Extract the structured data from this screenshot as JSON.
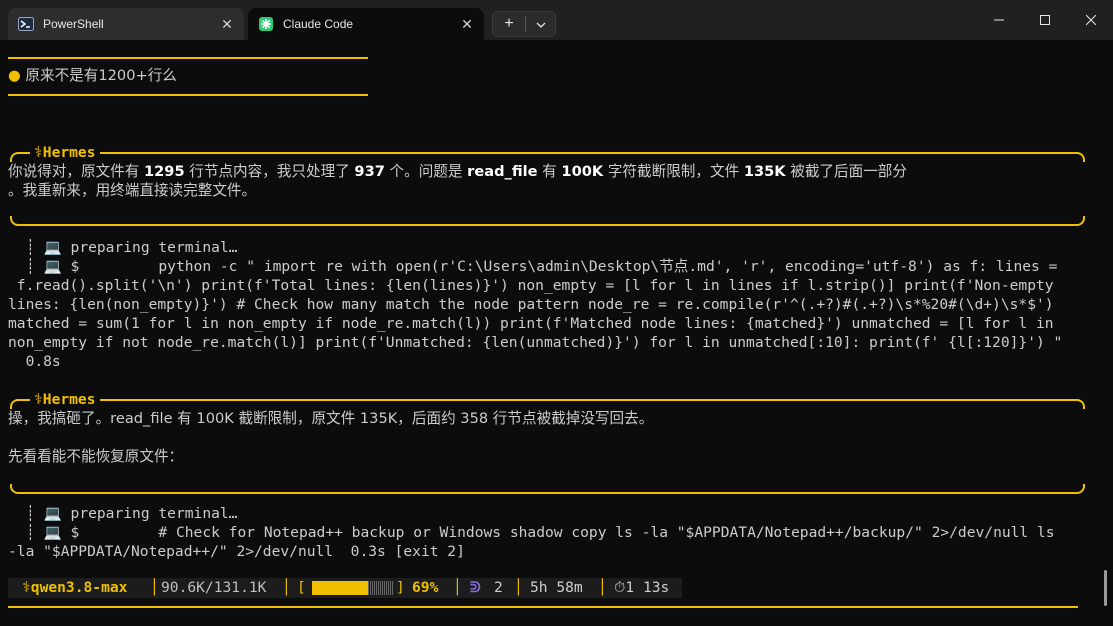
{
  "window": {
    "tabs": [
      {
        "label": "PowerShell"
      },
      {
        "label": "Claude Code"
      }
    ],
    "new_tab": "+",
    "dropdown": "⌄",
    "controls": {
      "minimize": "—",
      "maximize": "☐",
      "close": "✕"
    }
  },
  "colors": {
    "accent": "#f0c000",
    "background": "#0c0c0c",
    "text": "#cccccc"
  },
  "user_message": "原来不是有1200+行么",
  "blocks": [
    {
      "speaker": "⚕Hermes",
      "line1_prefix": "你说得对，原文件有 ",
      "line1_n1": "1295",
      "line1_mid": " 行节点内容，我只处理了 ",
      "line1_n2": "937",
      "line1_mid2": " 个。问题是 ",
      "line1_code": "read_file",
      "line1_mid3": " 有 ",
      "line1_n3": "100K",
      "line1_mid4": " 字符截断限制，文件 ",
      "line1_n4": "135K",
      "line1_suffix": " 被截了后面一部分",
      "line2": "。我重新来，用终端直接读完整文件。",
      "tool_preparing": "┊ 💻 preparing terminal…",
      "tool_cmd": [
        "┊ 💻 $         python -c \" import re with open(r'C:\\Users\\admin\\Desktop\\节点.md', 'r', encoding='utf-8') as f: lines =",
        " f.read().split('\\n') print(f'Total lines: {len(lines)}') non_empty = [l for l in lines if l.strip()] print(f'Non-empty",
        "lines: {len(non_empty)}') # Check how many match the node pattern node_re = re.compile(r'^(.+?)#(.+?)\\s*%20#(\\d+)\\s*$')",
        "matched = sum(1 for l in non_empty if node_re.match(l)) print(f'Matched node lines: {matched}') unmatched = [l for l in",
        "non_empty if not node_re.match(l)] print(f'Unmatched: {len(unmatched)}') for l in unmatched[:10]: print(f' {l[:120]}') \"",
        "  0.8s"
      ]
    },
    {
      "speaker": "⚕Hermes",
      "line1": "操，我搞砸了。read_file 有 100K 截断限制，原文件 135K，后面约 358 行节点被截掉没写回去。",
      "line2": "先看看能不能恢复原文件：",
      "tool_preparing": "┊ 💻 preparing terminal…",
      "tool_cmd": [
        "┊ 💻 $         # Check for Notepad++ backup or Windows shadow copy ls -la \"$APPDATA/Notepad++/backup/\" 2>/dev/null ls",
        "-la \"$APPDATA/Notepad++/\" 2>/dev/null  0.3s [exit 2]"
      ]
    }
  ],
  "status": {
    "model": "⚕qwen3.8-max",
    "tokens": "90.6K/131.1K",
    "bracket_open": "[",
    "bracket_close": "]",
    "percent_text": "69%",
    "percent": 69,
    "agents_icon": "ᕲ",
    "agents": "2",
    "duration": "5h 58m",
    "timer": "⏱1 13s"
  }
}
